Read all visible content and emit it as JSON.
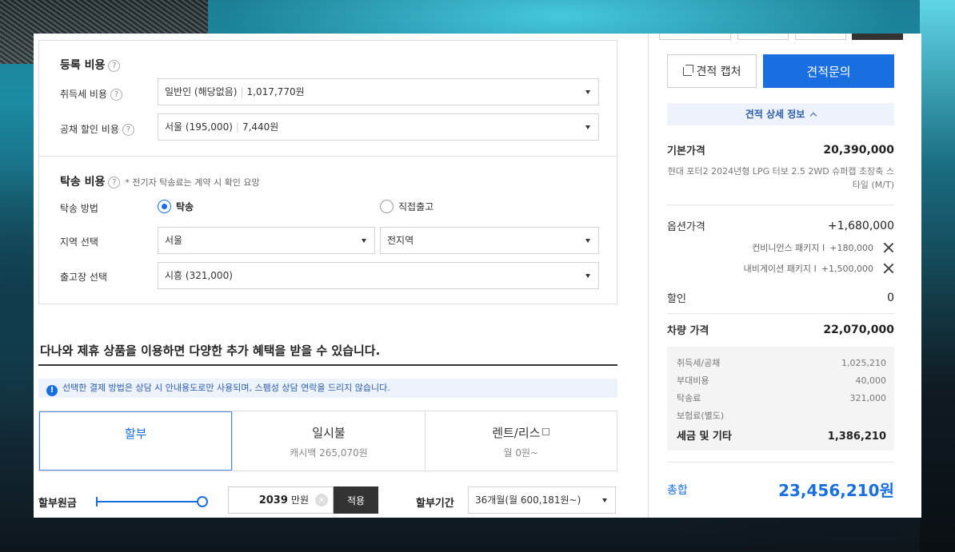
{
  "registration": {
    "title": "등록 비용",
    "help": "?",
    "acq_tax": {
      "label": "취득세 비용",
      "option": "일반인 (해당없음)",
      "amount": "1,017,770원"
    },
    "bond": {
      "label": "공채 할인 비용",
      "option": "서울 (195,000)",
      "amount": "7,440원"
    }
  },
  "shipping": {
    "title": "탁송 비용",
    "help": "?",
    "note": "* 전기자 탁송료는 계약 시 확인 요망",
    "method_label": "탁송 방법",
    "method_options": [
      {
        "label": "탁송",
        "selected": true
      },
      {
        "label": "직접출고",
        "selected": false
      }
    ],
    "region_label": "지역 선택",
    "region_value": "서울",
    "region_sub_value": "전지역",
    "depot_label": "출고장 선택",
    "depot_value": "시흥 (321,000)"
  },
  "benefit": {
    "title": "다나와 제휴 상품을 이용하면 다양한 추가 혜택을 받을 수 있습니다.",
    "info": "선택한 결제 방법은 상담 시 안내용도로만 사용되며, 스팸성 상담 연락을 드리지 않습니다.",
    "info_icon": "!",
    "tabs": [
      {
        "title": "할부",
        "sub": ""
      },
      {
        "title": "일시불",
        "sub": "캐시백 265,070원"
      },
      {
        "title": "렌트/리스",
        "sub": "월 0원~"
      }
    ],
    "principal_label": "할부원금",
    "principal_value": "2039",
    "principal_unit": "만원",
    "principal_slider_fraction": 1.0,
    "apply_label": "적용",
    "term_label": "할부기간",
    "term_value": "36개월(월 600,181원~)"
  },
  "summary": {
    "capture_label": "견적 캡처",
    "inquiry_label": "견적문의",
    "detail_toggle": "견적 상세 정보",
    "base_price_label": "기본가격",
    "base_price": "20,390,000",
    "model_desc": "현대 포터2 2024년형 LPG 터보 2.5 2WD 슈퍼캡 초장축 스타일 (M/T)",
    "option_price_label": "옵션가격",
    "option_price": "+1,680,000",
    "options": [
      {
        "name": "컨비니언스 패키지 I",
        "price": "+180,000"
      },
      {
        "name": "내비게이션 패키지 I",
        "price": "+1,500,000"
      }
    ],
    "discount_label": "할인",
    "discount": "0",
    "vehicle_price_label": "차량 가격",
    "vehicle_price": "22,070,000",
    "taxes": [
      {
        "label": "취득세/공채",
        "value": "1,025,210"
      },
      {
        "label": "부대비용",
        "value": "40,000"
      },
      {
        "label": "탁송료",
        "value": "321,000"
      },
      {
        "label": "보험료(별도)",
        "value": ""
      }
    ],
    "tax_total_label": "세금 및 기타",
    "tax_total": "1,386,210",
    "total_label": "총합",
    "total": "23,456,210원"
  },
  "colors": {
    "accent": "#1a6fe0",
    "info_bg": "#eef3fb"
  }
}
